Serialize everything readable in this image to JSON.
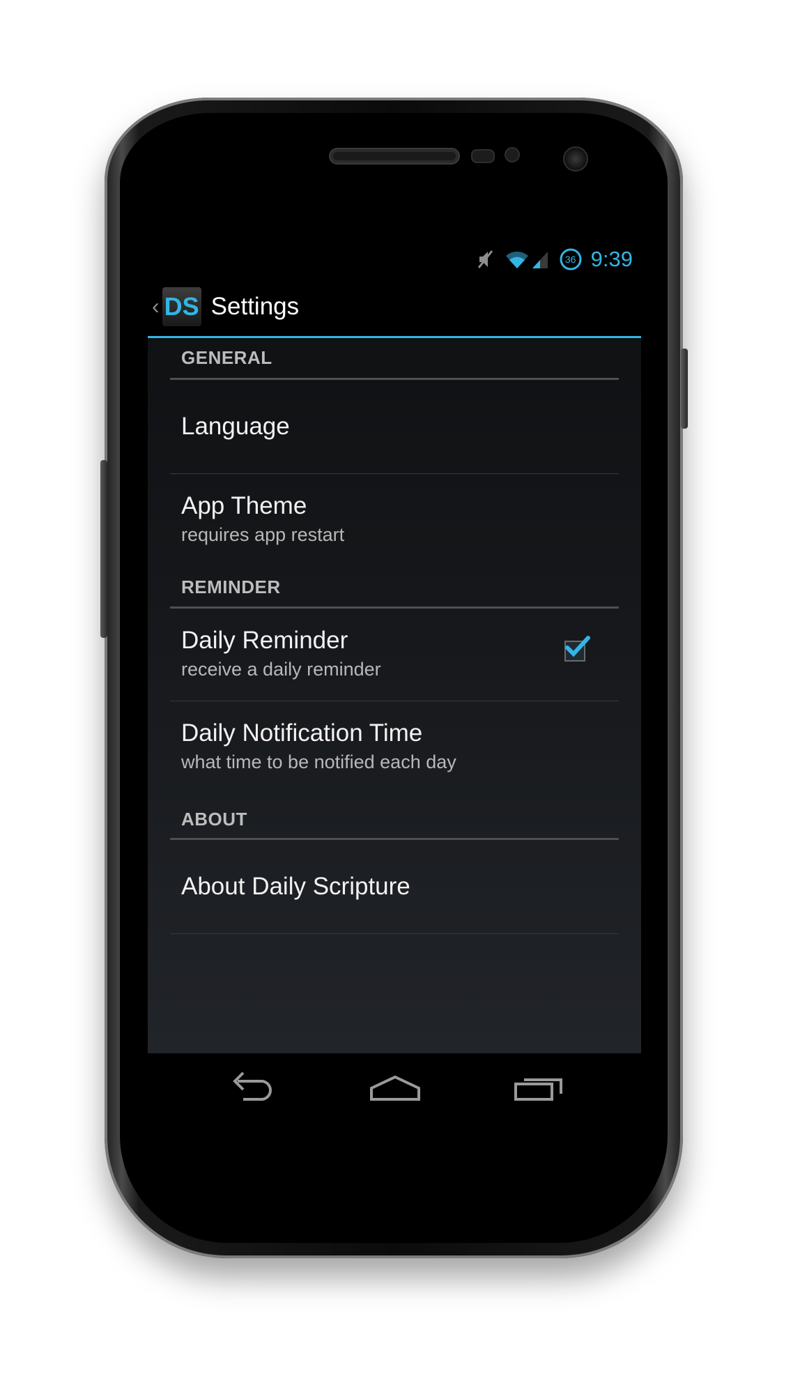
{
  "status_bar": {
    "time": "9:39",
    "icons": [
      "mute-icon",
      "wifi-icon",
      "signal-icon",
      "notification-badge-icon"
    ],
    "notification_badge": "36",
    "accent_color": "#33b5e5"
  },
  "action_bar": {
    "app_icon_text": "DS",
    "title": "Settings"
  },
  "sections": {
    "general": {
      "header": "GENERAL",
      "language": {
        "title": "Language"
      },
      "app_theme": {
        "title": "App Theme",
        "summary": "requires app restart"
      }
    },
    "reminder": {
      "header": "REMINDER",
      "daily_reminder": {
        "title": "Daily Reminder",
        "summary": "receive a daily reminder",
        "checked": true
      },
      "notification_time": {
        "title": "Daily Notification Time",
        "summary": "what time to be notified each day"
      }
    },
    "about": {
      "header": "ABOUT",
      "about_app": {
        "title": "About Daily Scripture"
      }
    }
  },
  "nav_bar": {
    "icons": [
      "back-icon",
      "home-icon",
      "recent-apps-icon"
    ]
  }
}
